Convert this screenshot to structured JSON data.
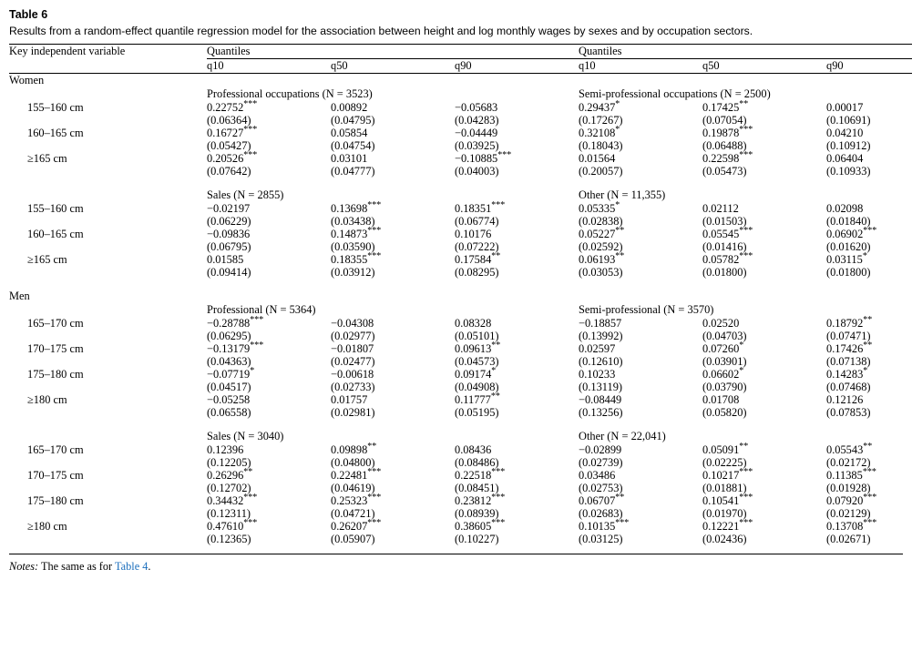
{
  "caption": {
    "label": "Table 6",
    "text": "Results from a random-effect quantile regression model for the association between height and log monthly wages by sexes and by occupation sectors."
  },
  "header": {
    "key_variable": "Key independent variable",
    "spanner_left": "Quantiles",
    "spanner_right": "Quantiles",
    "quantiles": [
      "q10",
      "q50",
      "q90"
    ]
  },
  "notes": {
    "prefix": "Notes:",
    "text": " The same as for ",
    "link": "Table 4",
    "suffix": "."
  },
  "groups": [
    {
      "name": "Women",
      "blocks": [
        {
          "left_sector": "Professional occupations (N = 3523)",
          "right_sector": "Semi-professional occupations (N = 2500)",
          "rows": [
            {
              "label": "155–160 cm",
              "left": [
                {
                  "coef": "0.22752",
                  "stars": "***",
                  "se": "(0.06364)"
                },
                {
                  "coef": "0.00892",
                  "stars": "",
                  "se": "(0.04795)"
                },
                {
                  "coef": "−0.05683",
                  "stars": "",
                  "se": "(0.04283)"
                }
              ],
              "right": [
                {
                  "coef": "0.29437",
                  "stars": "*",
                  "se": "(0.17267)"
                },
                {
                  "coef": "0.17425",
                  "stars": "**",
                  "se": "(0.07054)"
                },
                {
                  "coef": "0.00017",
                  "stars": "",
                  "se": "(0.10691)"
                }
              ]
            },
            {
              "label": "160–165 cm",
              "left": [
                {
                  "coef": "0.16727",
                  "stars": "***",
                  "se": "(0.05427)"
                },
                {
                  "coef": "0.05854",
                  "stars": "",
                  "se": "(0.04754)"
                },
                {
                  "coef": "−0.04449",
                  "stars": "",
                  "se": "(0.03925)"
                }
              ],
              "right": [
                {
                  "coef": "0.32108",
                  "stars": "*",
                  "se": "(0.18043)"
                },
                {
                  "coef": "0.19878",
                  "stars": "***",
                  "se": "(0.06488)"
                },
                {
                  "coef": "0.04210",
                  "stars": "",
                  "se": "(0.10912)"
                }
              ]
            },
            {
              "label": "≥165 cm",
              "left": [
                {
                  "coef": "0.20526",
                  "stars": "***",
                  "se": "(0.07642)"
                },
                {
                  "coef": "0.03101",
                  "stars": "",
                  "se": "(0.04777)"
                },
                {
                  "coef": "−0.10885",
                  "stars": "***",
                  "se": "(0.04003)"
                }
              ],
              "right": [
                {
                  "coef": "0.01564",
                  "stars": "",
                  "se": "(0.20057)"
                },
                {
                  "coef": "0.22598",
                  "stars": "***",
                  "se": "(0.05473)"
                },
                {
                  "coef": "0.06404",
                  "stars": "",
                  "se": "(0.10933)"
                }
              ]
            }
          ]
        },
        {
          "left_sector": "Sales (N = 2855)",
          "right_sector": "Other (N = 11,355)",
          "rows": [
            {
              "label": "155–160 cm",
              "left": [
                {
                  "coef": "−0.02197",
                  "stars": "",
                  "se": "(0.06229)"
                },
                {
                  "coef": "0.13698",
                  "stars": "***",
                  "se": "(0.03438)"
                },
                {
                  "coef": "0.18351",
                  "stars": "***",
                  "se": "(0.06774)"
                }
              ],
              "right": [
                {
                  "coef": "0.05335",
                  "stars": "*",
                  "se": "(0.02838)"
                },
                {
                  "coef": "0.02112",
                  "stars": "",
                  "se": "(0.01503)"
                },
                {
                  "coef": "0.02098",
                  "stars": "",
                  "se": "(0.01840)"
                }
              ]
            },
            {
              "label": "160–165 cm",
              "left": [
                {
                  "coef": "−0.09836",
                  "stars": "",
                  "se": "(0.06795)"
                },
                {
                  "coef": "0.14873",
                  "stars": "***",
                  "se": "(0.03590)"
                },
                {
                  "coef": "0.10176",
                  "stars": "",
                  "se": "(0.07222)"
                }
              ],
              "right": [
                {
                  "coef": "0.05227",
                  "stars": "**",
                  "se": "(0.02592)"
                },
                {
                  "coef": "0.05545",
                  "stars": "***",
                  "se": "(0.01416)"
                },
                {
                  "coef": "0.06902",
                  "stars": "***",
                  "se": "(0.01620)"
                }
              ]
            },
            {
              "label": "≥165 cm",
              "left": [
                {
                  "coef": "0.01585",
                  "stars": "",
                  "se": "(0.09414)"
                },
                {
                  "coef": "0.18355",
                  "stars": "***",
                  "se": "(0.03912)"
                },
                {
                  "coef": "0.17584",
                  "stars": "**",
                  "se": "(0.08295)"
                }
              ],
              "right": [
                {
                  "coef": "0.06193",
                  "stars": "**",
                  "se": "(0.03053)"
                },
                {
                  "coef": "0.05782",
                  "stars": "***",
                  "se": "(0.01800)"
                },
                {
                  "coef": "0.03115",
                  "stars": "*",
                  "se": "(0.01800)"
                }
              ]
            }
          ]
        }
      ]
    },
    {
      "name": "Men",
      "blocks": [
        {
          "left_sector": "Professional (N = 5364)",
          "right_sector": "Semi-professional (N = 3570)",
          "rows": [
            {
              "label": "165–170 cm",
              "left": [
                {
                  "coef": "−0.28788",
                  "stars": "***",
                  "se": "(0.06295)"
                },
                {
                  "coef": "−0.04308",
                  "stars": "",
                  "se": "(0.02977)"
                },
                {
                  "coef": "0.08328",
                  "stars": "",
                  "se": "(0.05101)"
                }
              ],
              "right": [
                {
                  "coef": "−0.18857",
                  "stars": "",
                  "se": "(0.13992)"
                },
                {
                  "coef": "0.02520",
                  "stars": "",
                  "se": "(0.04703)"
                },
                {
                  "coef": "0.18792",
                  "stars": "**",
                  "se": "(0.07471)"
                }
              ]
            },
            {
              "label": "170–175 cm",
              "left": [
                {
                  "coef": "−0.13179",
                  "stars": "***",
                  "se": "(0.04363)"
                },
                {
                  "coef": "−0.01807",
                  "stars": "",
                  "se": "(0.02477)"
                },
                {
                  "coef": "0.09613",
                  "stars": "**",
                  "se": "(0.04573)"
                }
              ],
              "right": [
                {
                  "coef": "0.02597",
                  "stars": "",
                  "se": "(0.12610)"
                },
                {
                  "coef": "0.07260",
                  "stars": "*",
                  "se": "(0.03901)"
                },
                {
                  "coef": "0.17426",
                  "stars": "**",
                  "se": "(0.07138)"
                }
              ]
            },
            {
              "label": "175–180 cm",
              "left": [
                {
                  "coef": "−0.07719",
                  "stars": "*",
                  "se": "(0.04517)"
                },
                {
                  "coef": "−0.00618",
                  "stars": "",
                  "se": "(0.02733)"
                },
                {
                  "coef": "0.09174",
                  "stars": "*",
                  "se": "(0.04908)"
                }
              ],
              "right": [
                {
                  "coef": "0.10233",
                  "stars": "",
                  "se": "(0.13119)"
                },
                {
                  "coef": "0.06602",
                  "stars": "*",
                  "se": "(0.03790)"
                },
                {
                  "coef": "0.14283",
                  "stars": "*",
                  "se": "(0.07468)"
                }
              ]
            },
            {
              "label": "≥180 cm",
              "left": [
                {
                  "coef": "−0.05258",
                  "stars": "",
                  "se": "(0.06558)"
                },
                {
                  "coef": "0.01757",
                  "stars": "",
                  "se": "(0.02981)"
                },
                {
                  "coef": "0.11777",
                  "stars": "**",
                  "se": "(0.05195)"
                }
              ],
              "right": [
                {
                  "coef": "−0.08449",
                  "stars": "",
                  "se": "(0.13256)"
                },
                {
                  "coef": "0.01708",
                  "stars": "",
                  "se": "(0.05820)"
                },
                {
                  "coef": "0.12126",
                  "stars": "",
                  "se": "(0.07853)"
                }
              ]
            }
          ]
        },
        {
          "left_sector": "Sales (N = 3040)",
          "right_sector": "Other (N = 22,041)",
          "rows": [
            {
              "label": "165–170 cm",
              "left": [
                {
                  "coef": "0.12396",
                  "stars": "",
                  "se": "(0.12205)"
                },
                {
                  "coef": "0.09898",
                  "stars": "**",
                  "se": "(0.04800)"
                },
                {
                  "coef": "0.08436",
                  "stars": "",
                  "se": "(0.08486)"
                }
              ],
              "right": [
                {
                  "coef": "−0.02899",
                  "stars": "",
                  "se": "(0.02739)"
                },
                {
                  "coef": "0.05091",
                  "stars": "**",
                  "se": "(0.02225)"
                },
                {
                  "coef": "0.05543",
                  "stars": "**",
                  "se": "(0.02172)"
                }
              ]
            },
            {
              "label": "170–175 cm",
              "left": [
                {
                  "coef": "0.26296",
                  "stars": "**",
                  "se": "(0.12702)"
                },
                {
                  "coef": "0.22481",
                  "stars": "***",
                  "se": "(0.04619)"
                },
                {
                  "coef": "0.22518",
                  "stars": "***",
                  "se": "(0.08451)"
                }
              ],
              "right": [
                {
                  "coef": "0.03486",
                  "stars": "",
                  "se": "(0.02753)"
                },
                {
                  "coef": "0.10217",
                  "stars": "***",
                  "se": "(0.01881)"
                },
                {
                  "coef": "0.11385",
                  "stars": "***",
                  "se": "(0.01928)"
                }
              ]
            },
            {
              "label": "175–180 cm",
              "left": [
                {
                  "coef": "0.34432",
                  "stars": "***",
                  "se": "(0.12311)"
                },
                {
                  "coef": "0.25323",
                  "stars": "***",
                  "se": "(0.04721)"
                },
                {
                  "coef": "0.23812",
                  "stars": "***",
                  "se": "(0.08939)"
                }
              ],
              "right": [
                {
                  "coef": "0.06707",
                  "stars": "**",
                  "se": "(0.02683)"
                },
                {
                  "coef": "0.10541",
                  "stars": "***",
                  "se": "(0.01970)"
                },
                {
                  "coef": "0.07920",
                  "stars": "***",
                  "se": "(0.02129)"
                }
              ]
            },
            {
              "label": "≥180 cm",
              "left": [
                {
                  "coef": "0.47610",
                  "stars": "***",
                  "se": "(0.12365)"
                },
                {
                  "coef": "0.26207",
                  "stars": "***",
                  "se": "(0.05907)"
                },
                {
                  "coef": "0.38605",
                  "stars": "***",
                  "se": "(0.10227)"
                }
              ],
              "right": [
                {
                  "coef": "0.10135",
                  "stars": "***",
                  "se": "(0.03125)"
                },
                {
                  "coef": "0.12221",
                  "stars": "***",
                  "se": "(0.02436)"
                },
                {
                  "coef": "0.13708",
                  "stars": "***",
                  "se": "(0.02671)"
                }
              ]
            }
          ]
        }
      ]
    }
  ]
}
